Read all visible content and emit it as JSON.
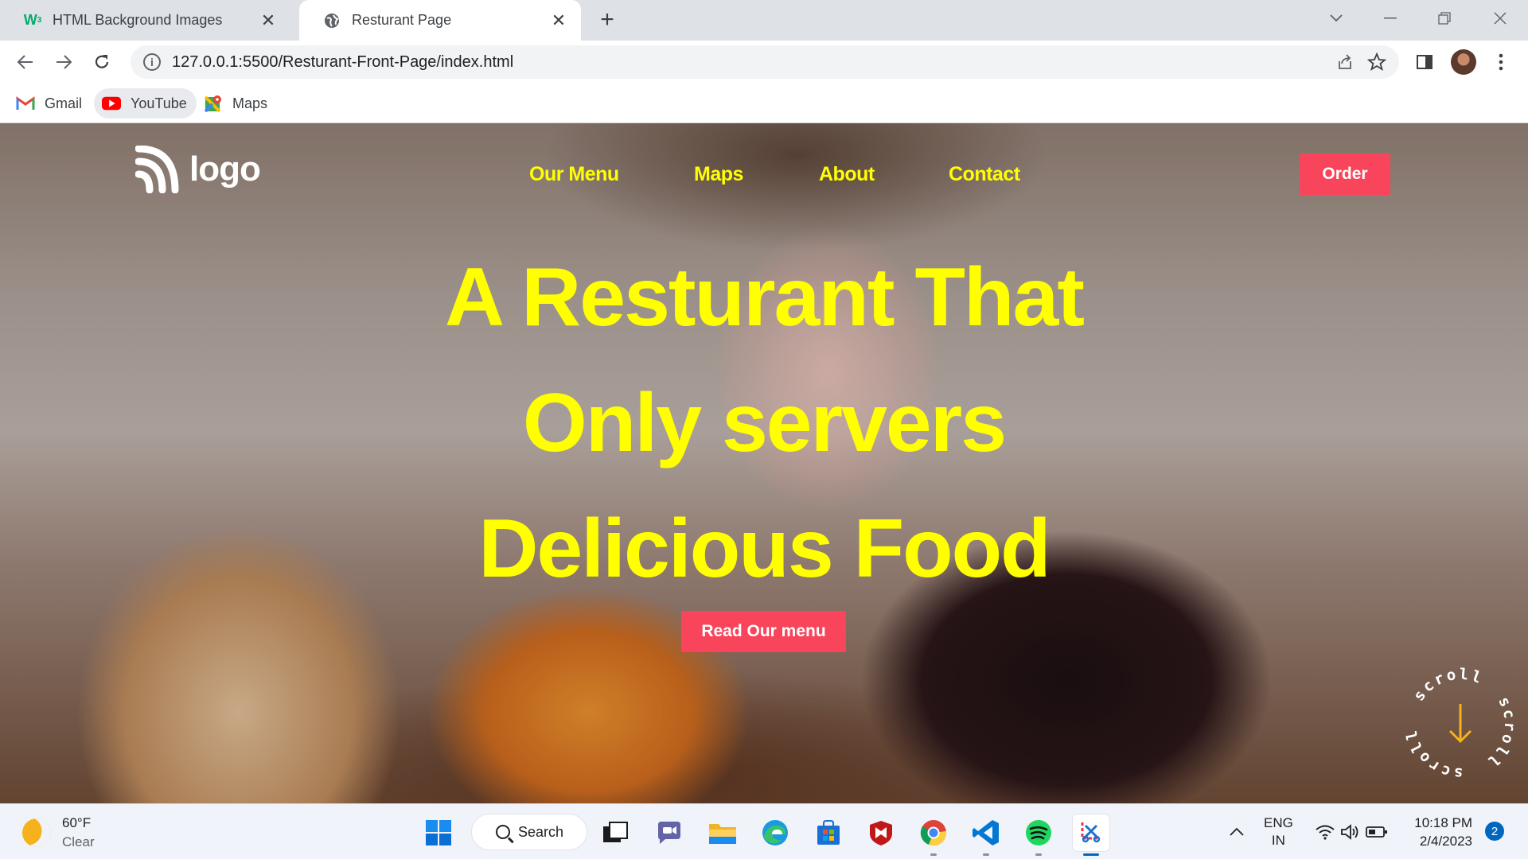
{
  "browser": {
    "tabs": [
      {
        "title": "HTML Background Images",
        "favicon": "w3schools-icon",
        "active": false
      },
      {
        "title": "Resturant Page",
        "favicon": "globe-icon",
        "active": true
      }
    ],
    "url": "127.0.0.1:5500/Resturant-Front-Page/index.html",
    "bookmarks": [
      {
        "label": "Gmail",
        "icon": "gmail-icon"
      },
      {
        "label": "YouTube",
        "icon": "youtube-icon"
      },
      {
        "label": "Maps",
        "icon": "maps-icon"
      }
    ]
  },
  "site": {
    "logo_text": "logo",
    "nav": [
      "Our Menu",
      "Maps",
      "About",
      "Contact"
    ],
    "order_label": "Order",
    "headline": [
      "A Resturant That",
      "Only servers",
      "Delicious Food"
    ],
    "menu_button": "Read Our menu",
    "scroll_text": "scroll",
    "accent_color": "#ffff00",
    "button_color": "#f9455b"
  },
  "taskbar": {
    "weather_temp": "60°F",
    "weather_desc": "Clear",
    "search_label": "Search",
    "lang_top": "ENG",
    "lang_bottom": "IN",
    "time": "10:18 PM",
    "date": "2/4/2023",
    "notification_count": "2"
  }
}
